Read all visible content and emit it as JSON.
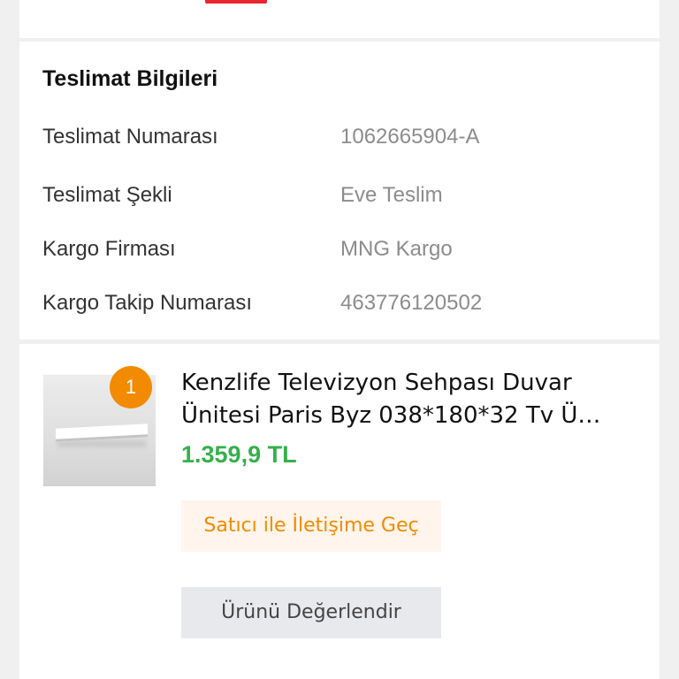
{
  "delivery": {
    "title": "Teslimat Bilgileri",
    "rows": [
      {
        "label": "Teslimat Numarası",
        "value": "1062665904-A"
      },
      {
        "label": "Teslimat Şekli",
        "value": "Eve Teslim"
      },
      {
        "label": "Kargo Firması",
        "value": "MNG Kargo"
      },
      {
        "label": "Kargo Takip Numarası",
        "value": "463776120502"
      }
    ]
  },
  "product": {
    "quantity": "1",
    "title": "Kenzlife Televizyon Sehpası Duvar\nÜnitesi Paris Byz 038*180*32 Tv Ü…",
    "price": "1.359,9 TL",
    "contact_seller_label": "Satıcı ile İletişime Geç",
    "review_label": "Ürünü Değerlendir"
  },
  "colors": {
    "accent_orange": "#f28b00",
    "price_green": "#35b04b",
    "top_badge_red": "#e8262b"
  }
}
